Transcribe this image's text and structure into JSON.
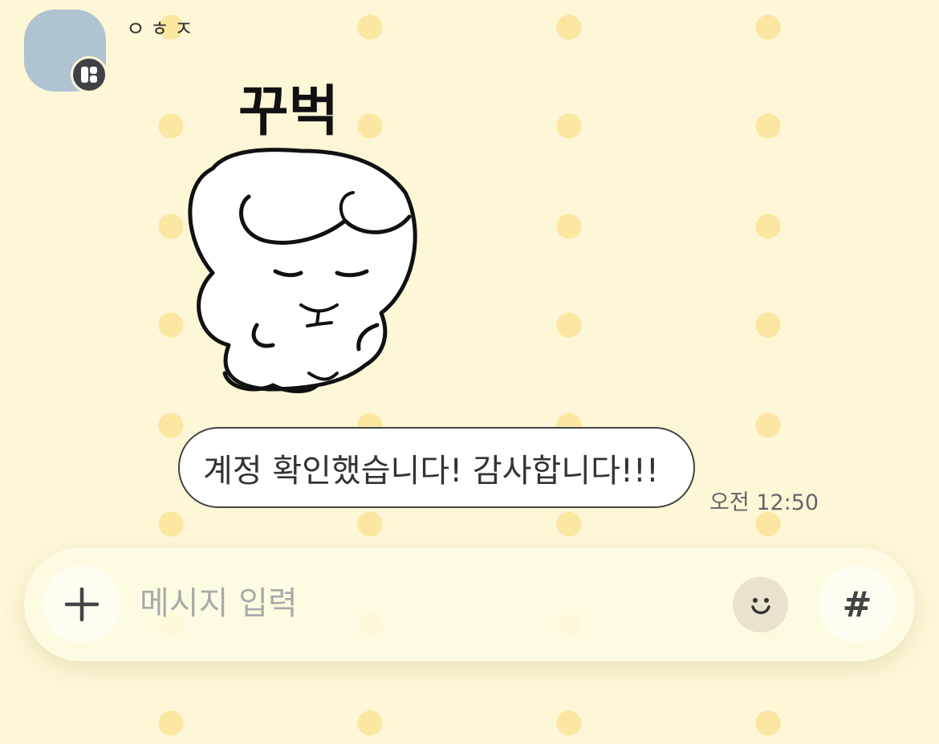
{
  "chat": {
    "sender": {
      "name": "ㅇㅎㅈ",
      "avatar_color": "#afc3d1",
      "badge_icon": "channel-badge-icon"
    },
    "sticker": {
      "text": "꾸벅",
      "icon": "bowing-character-sticker"
    },
    "message": {
      "text": "계정 확인했습니다! 감사합니다!!!",
      "time": "오전 12:50"
    }
  },
  "input_bar": {
    "placeholder": "메시지 입력",
    "value": "",
    "plus_icon": "plus-icon",
    "emoji_icon": "smiley-icon",
    "hash_label": "#"
  },
  "colors": {
    "background": "#fdf6d7",
    "dots": "#fbe7a2",
    "bubble": "#ffffff"
  }
}
